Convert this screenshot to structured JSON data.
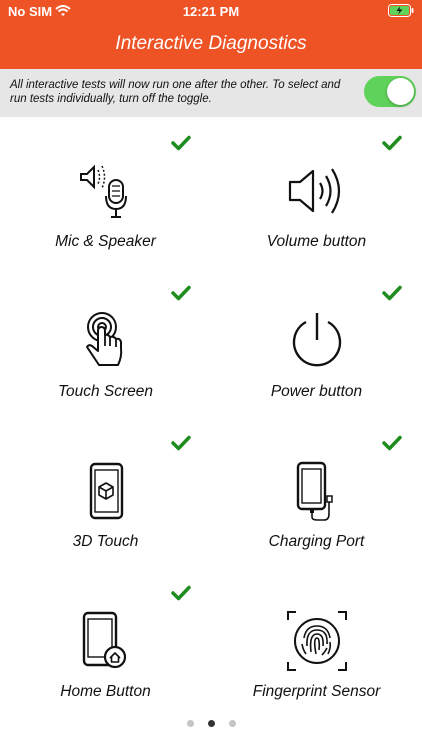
{
  "status": {
    "carrier": "No SIM",
    "time": "12:21 PM"
  },
  "header": {
    "title": "Interactive Diagnostics"
  },
  "banner": {
    "text": "All interactive tests will now run one after the other. To select and run tests individually, turn off the toggle.",
    "toggle_on": true
  },
  "tests": [
    {
      "label": "Mic & Speaker",
      "icon": "mic-speaker-icon",
      "passed": true
    },
    {
      "label": "Volume button",
      "icon": "volume-icon",
      "passed": true
    },
    {
      "label": "Touch Screen",
      "icon": "touch-icon",
      "passed": true
    },
    {
      "label": "Power button",
      "icon": "power-icon",
      "passed": true
    },
    {
      "label": "3D Touch",
      "icon": "3d-touch-icon",
      "passed": true
    },
    {
      "label": "Charging Port",
      "icon": "charging-port-icon",
      "passed": true
    },
    {
      "label": "Home Button",
      "icon": "home-button-icon",
      "passed": true
    },
    {
      "label": "Fingerprint Sensor",
      "icon": "fingerprint-icon",
      "passed": false
    }
  ],
  "pager": {
    "pages": 3,
    "current": 1
  },
  "colors": {
    "header": "#ee5326",
    "banner": "#e6e6e6",
    "toggle": "#5fd259",
    "check": "#1e8c1e"
  }
}
